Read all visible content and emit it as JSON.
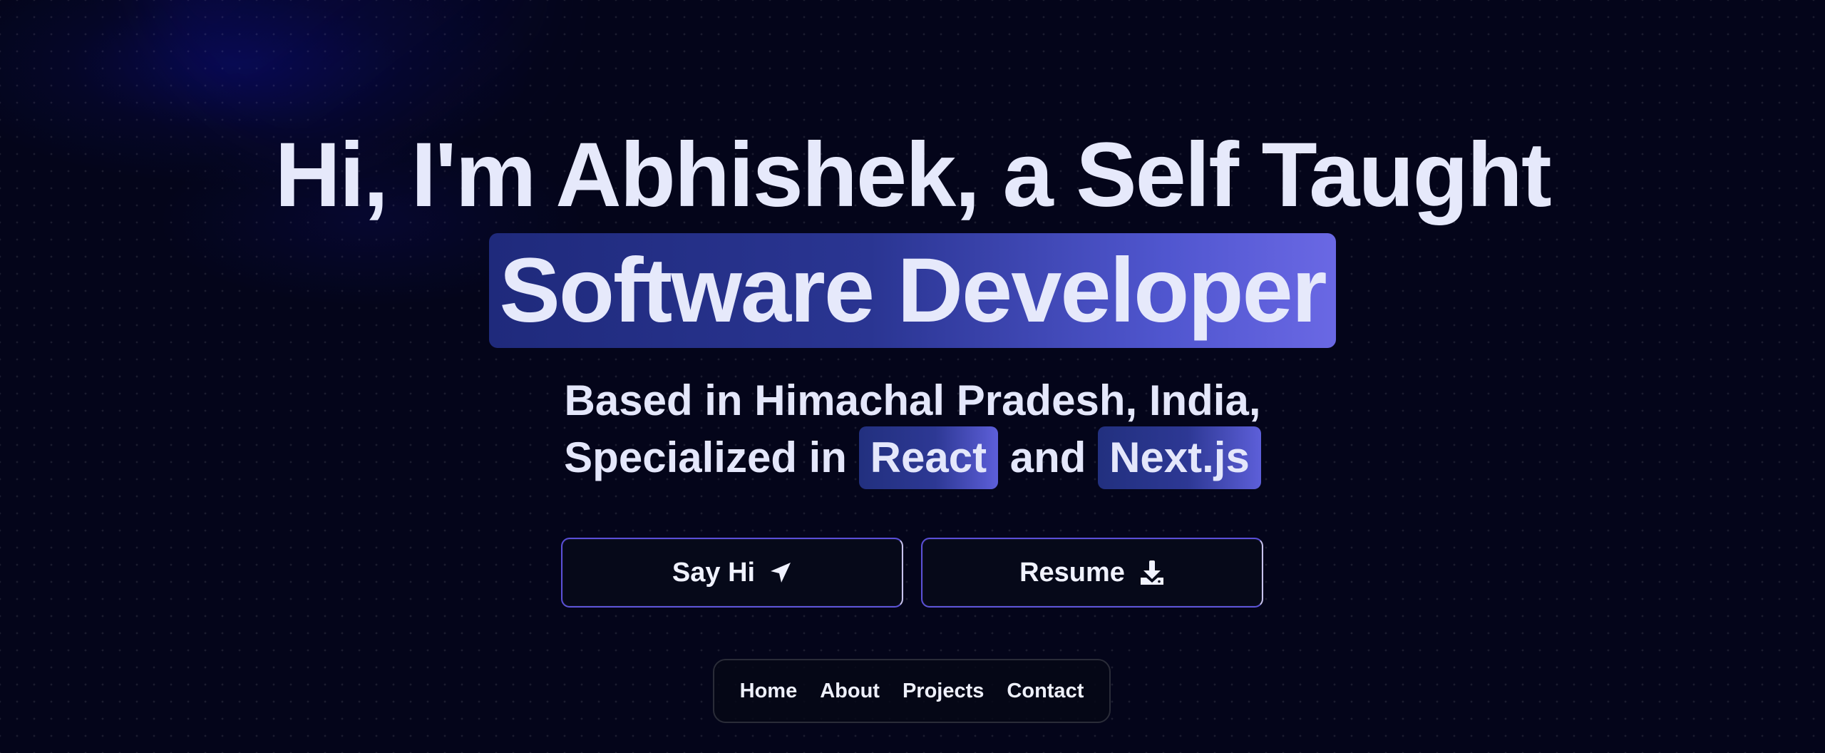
{
  "hero": {
    "line1": "Hi, I'm Abhishek, a Self Taught",
    "highlight": "Software Developer",
    "location_line": "Based in Himachal Pradesh, India,",
    "specialized_prefix": "Specialized in",
    "tech1": "React",
    "connector": "and",
    "tech2": "Next.js"
  },
  "buttons": {
    "say_hi": "Say Hi",
    "say_hi_icon": "paper-plane-icon",
    "resume": "Resume",
    "resume_icon": "download-icon"
  },
  "nav": {
    "items": [
      "Home",
      "About",
      "Projects",
      "Contact"
    ]
  },
  "colors": {
    "background": "#04051a",
    "text": "#e6e9fb",
    "highlight_start": "#1f2a7c",
    "highlight_end": "#6a68e4",
    "button_border": "#5a4fd8"
  }
}
